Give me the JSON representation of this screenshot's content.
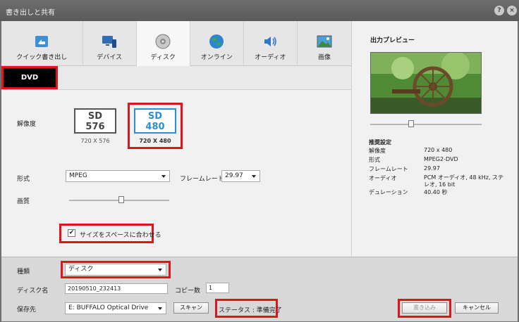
{
  "window": {
    "title": "書き出しと共有",
    "help_icon": "?",
    "close_icon": "×"
  },
  "tabs": [
    {
      "label": "クイック書き出し",
      "icon": "quick-export-icon"
    },
    {
      "label": "デバイス",
      "icon": "device-icon"
    },
    {
      "label": "ディスク",
      "icon": "disc-icon"
    },
    {
      "label": "オンライン",
      "icon": "globe-icon"
    },
    {
      "label": "オーディオ",
      "icon": "speaker-icon"
    },
    {
      "label": "画像",
      "icon": "image-icon"
    }
  ],
  "active_tab": "ディスク",
  "subtab": {
    "label": "DVD"
  },
  "resolution": {
    "label": "解像度",
    "options": [
      {
        "line1": "SD",
        "line2": "576",
        "caption": "720 X 576"
      },
      {
        "line1": "SD",
        "line2": "480",
        "caption": "720 X 480"
      }
    ],
    "selected": "480"
  },
  "format": {
    "label": "形式",
    "value": "MPEG"
  },
  "framerate": {
    "label": "フレームレート",
    "value": "29.97"
  },
  "quality": {
    "label": "画質",
    "level": 0.52
  },
  "fit_checkbox": {
    "label": "サイズをスペースに合わせる",
    "checked": true
  },
  "preview": {
    "title": "出力プレビュー",
    "slider_level": 0.37,
    "settings_title": "推奨設定",
    "settings": [
      {
        "key": "解像度",
        "value": "720 x 480"
      },
      {
        "key": "形式",
        "value": "MPEG2-DVD"
      },
      {
        "key": "フレームレート",
        "value": "29.97"
      },
      {
        "key": "オーディオ",
        "value": "PCM オーディオ, 48 kHz, ステレオ, 16 bit"
      },
      {
        "key": "デュレーション",
        "value": "40.40 秒"
      }
    ]
  },
  "bottom": {
    "type_label": "種類",
    "type_value": "ディスク",
    "disc_name_label": "ディスク名",
    "disc_name_value": "20190510_232413",
    "copies_label": "コピー数",
    "copies_value": "1",
    "save_to_label": "保存先",
    "save_to_value": "E: BUFFALO Optical Drive",
    "scan_button": "スキャン",
    "status_text": "ステータス : 準備完了",
    "write_button": "書き込み",
    "cancel_button": "キャンセル"
  },
  "colors": {
    "accent_red": "#e1141c",
    "selected_blue": "#2b8fd6"
  }
}
